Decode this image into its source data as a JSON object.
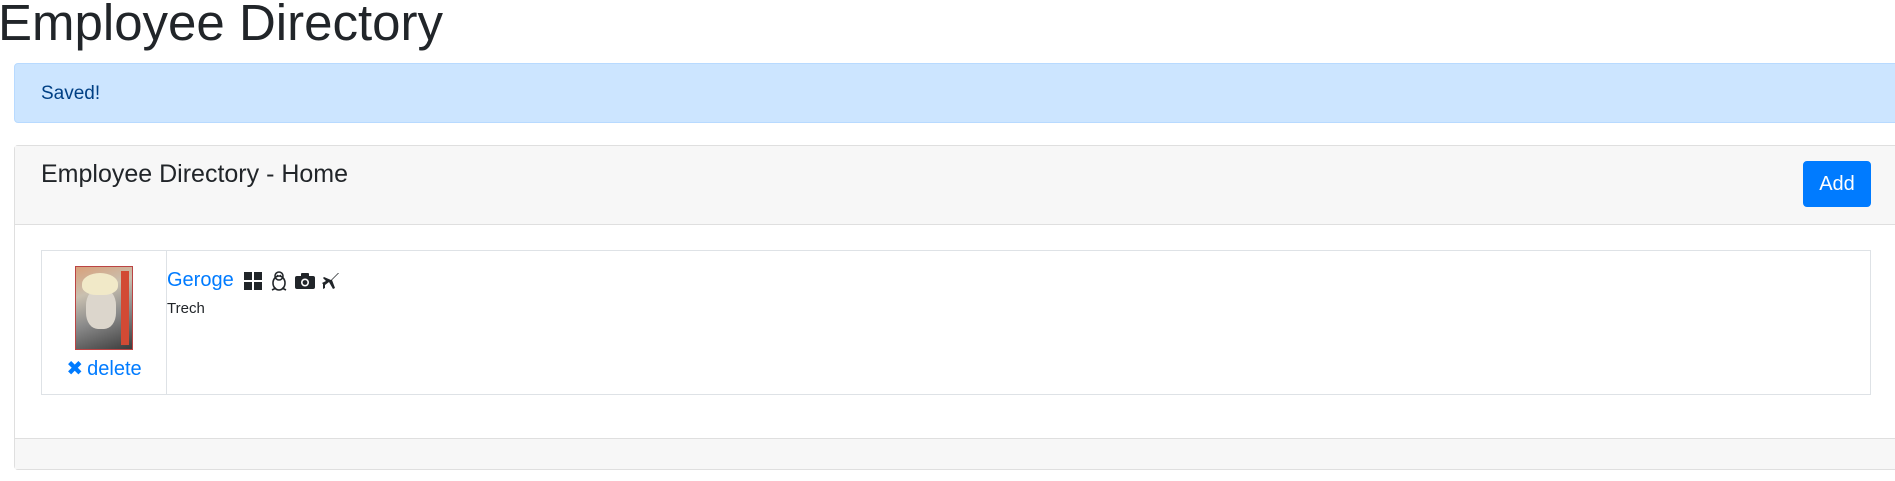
{
  "page": {
    "title": "Employee Directory"
  },
  "alert": {
    "message": "Saved!"
  },
  "card": {
    "title": "Employee Directory - Home",
    "add_label": "Add"
  },
  "employees": [
    {
      "name": "Geroge",
      "department": "Trech",
      "delete_label": "delete",
      "icons": [
        "windows-icon",
        "linux-penguin-icon",
        "camera-icon",
        "airplane-icon"
      ]
    }
  ],
  "colors": {
    "primary": "#007bff",
    "alert_bg": "#cce5ff",
    "alert_text": "#004085"
  }
}
